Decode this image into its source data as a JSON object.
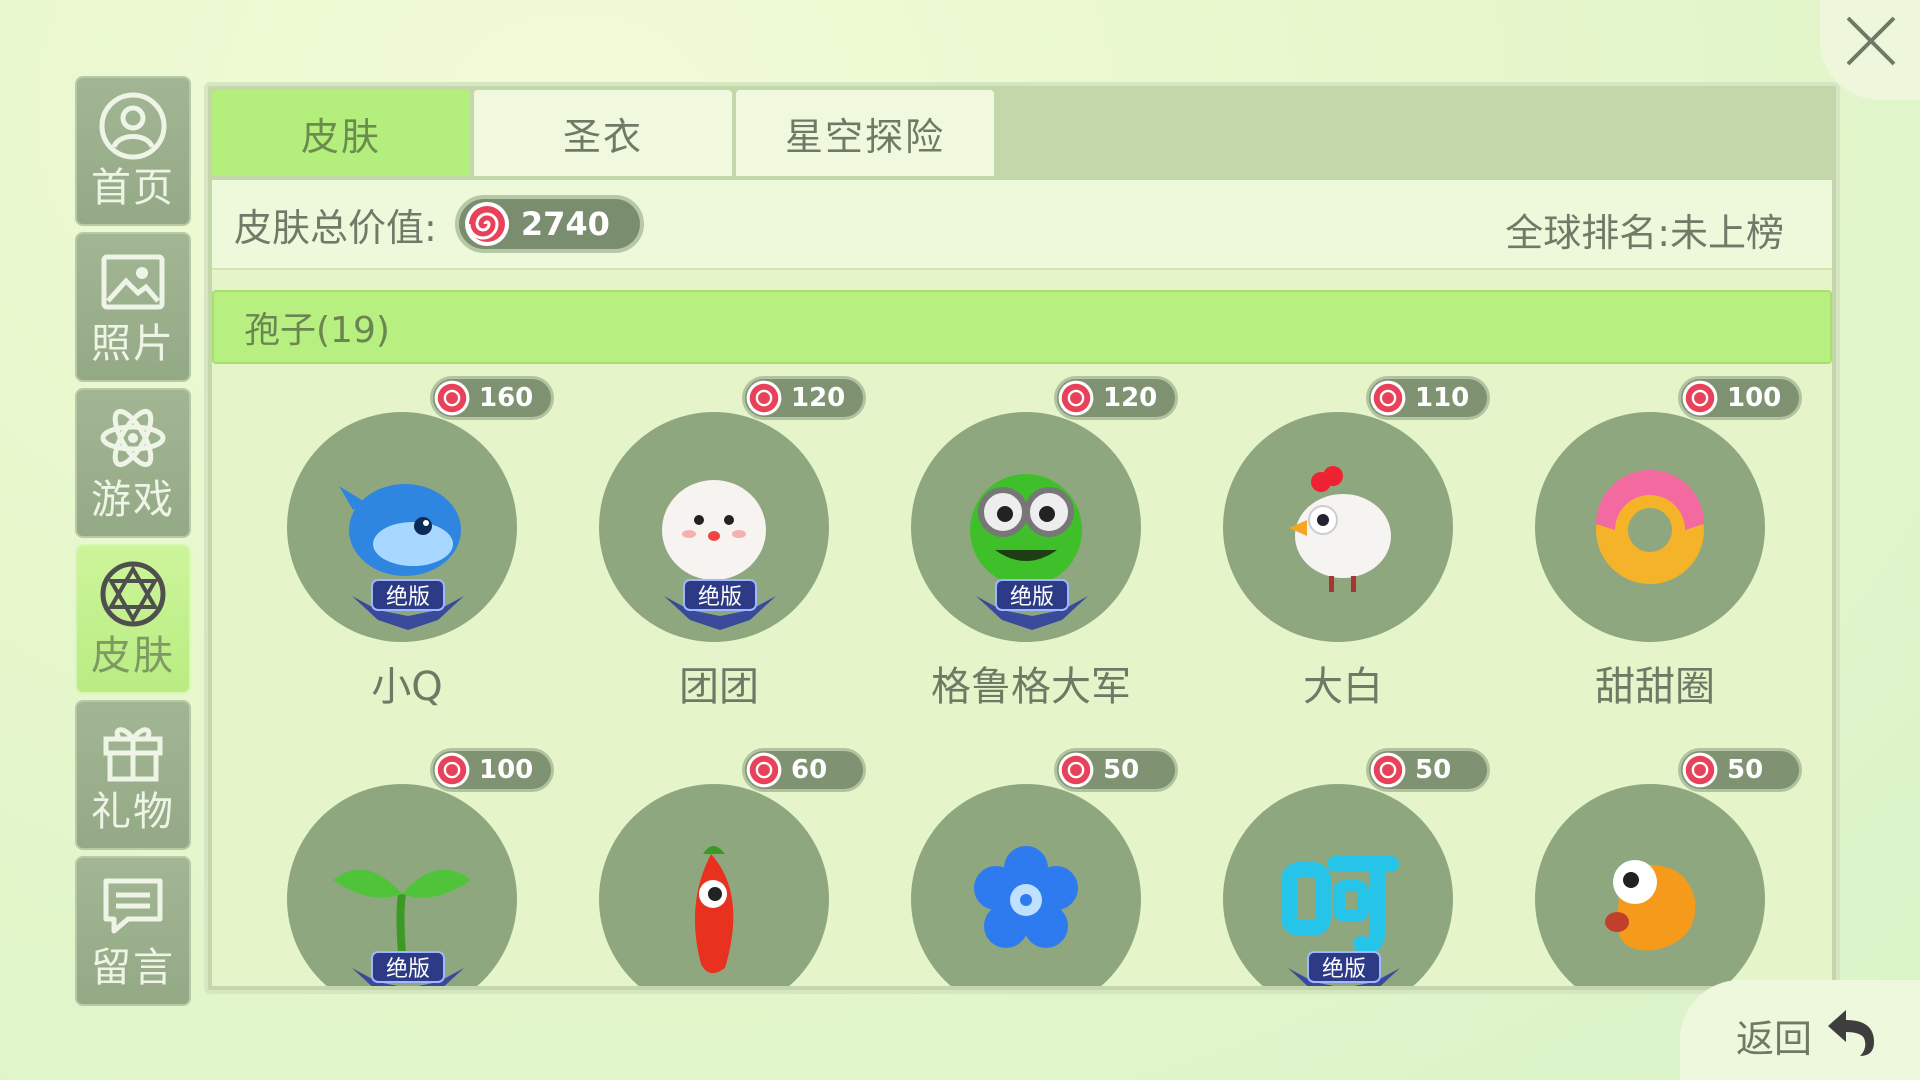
{
  "sidebar": {
    "items": [
      {
        "label": "首页",
        "icon": "person-icon",
        "active": false
      },
      {
        "label": "照片",
        "icon": "photo-icon",
        "active": false
      },
      {
        "label": "游戏",
        "icon": "atom-icon",
        "active": false
      },
      {
        "label": "皮肤",
        "icon": "skin-icon",
        "active": true
      },
      {
        "label": "礼物",
        "icon": "gift-icon",
        "active": false
      },
      {
        "label": "留言",
        "icon": "message-icon",
        "active": false
      }
    ]
  },
  "tabs": [
    {
      "label": "皮肤",
      "active": true
    },
    {
      "label": "圣衣",
      "active": false
    },
    {
      "label": "星空探险",
      "active": false
    }
  ],
  "summary": {
    "total_label": "皮肤总价值:",
    "total_value": "2740",
    "rank_text": "全球排名:未上榜"
  },
  "category": {
    "label": "孢子(19)"
  },
  "skins": [
    {
      "name": "小Q",
      "price": "160",
      "badge": "绝版",
      "icon": "blue-whale-icon"
    },
    {
      "name": "团团",
      "price": "120",
      "badge": "绝版",
      "icon": "white-blob-icon"
    },
    {
      "name": "格鲁格大军",
      "price": "120",
      "badge": "绝版",
      "icon": "green-goggles-icon"
    },
    {
      "name": "大白",
      "price": "110",
      "badge": "",
      "icon": "chicken-icon"
    },
    {
      "name": "甜甜圈",
      "price": "100",
      "badge": "",
      "icon": "donut-icon"
    },
    {
      "name": "",
      "price": "100",
      "badge": "绝版",
      "icon": "sprout-icon"
    },
    {
      "name": "",
      "price": "60",
      "badge": "",
      "icon": "chili-icon"
    },
    {
      "name": "",
      "price": "50",
      "badge": "",
      "icon": "flower-icon"
    },
    {
      "name": "",
      "price": "50",
      "badge": "绝版",
      "icon": "text-he-icon"
    },
    {
      "name": "",
      "price": "50",
      "badge": "",
      "icon": "orange-bird-icon"
    }
  ],
  "back": {
    "label": "返回"
  },
  "colors": {
    "accent": "#b7ef80",
    "circle": "#8fa77e",
    "candy": "#e8415a"
  }
}
